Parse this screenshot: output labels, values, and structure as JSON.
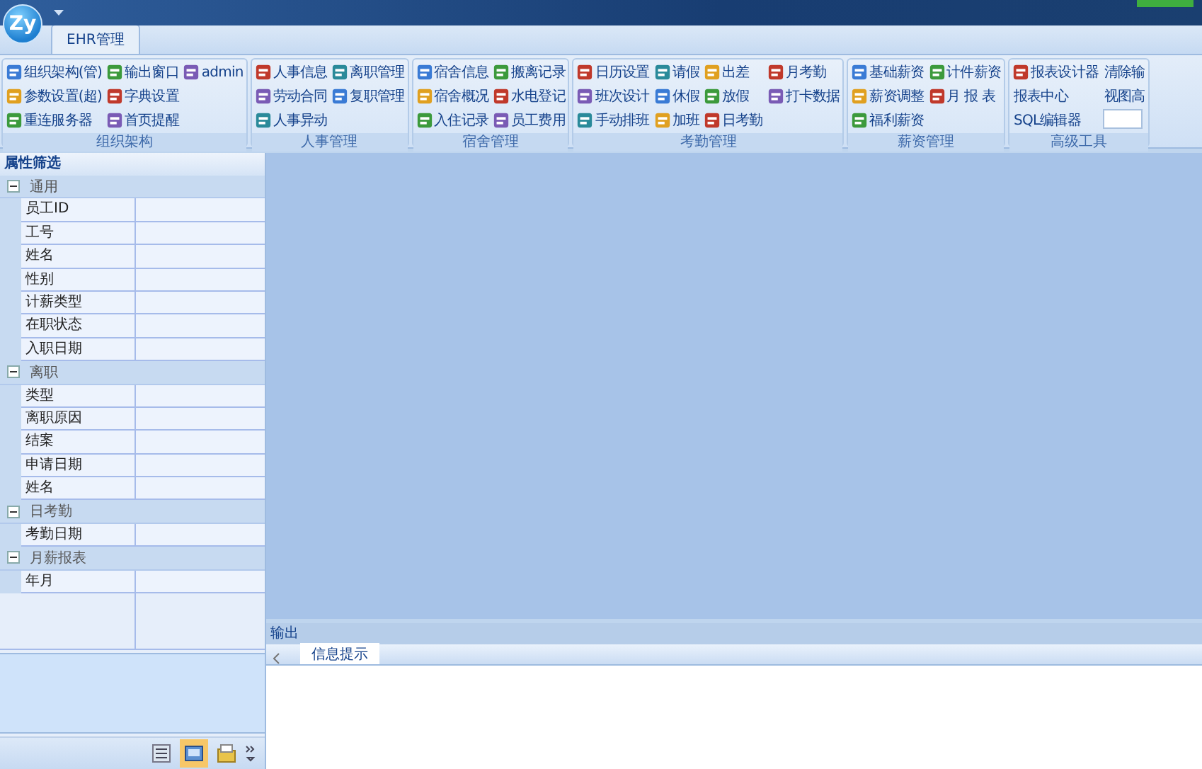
{
  "app": {
    "logo": "Zy"
  },
  "tabs": [
    {
      "label": "EHR管理",
      "selected": true
    }
  ],
  "ribbon": [
    {
      "title": "组织架构",
      "columns": [
        [
          {
            "label": "组织架构(管)",
            "kind": "icon"
          },
          {
            "label": "参数设置(超)",
            "kind": "icon"
          },
          {
            "label": "重连服务器",
            "kind": "icon"
          }
        ],
        [
          {
            "label": "输出窗口",
            "kind": "icon"
          },
          {
            "label": "字典设置",
            "kind": "icon"
          },
          {
            "label": "首页提醒",
            "kind": "icon"
          }
        ],
        [
          {
            "label": "admin",
            "kind": "icon"
          }
        ]
      ]
    },
    {
      "title": "人事管理",
      "columns": [
        [
          {
            "label": "人事信息",
            "kind": "icon"
          },
          {
            "label": "劳动合同",
            "kind": "icon"
          },
          {
            "label": "人事异动",
            "kind": "icon"
          }
        ],
        [
          {
            "label": "离职管理",
            "kind": "icon"
          },
          {
            "label": "复职管理",
            "kind": "icon"
          }
        ]
      ]
    },
    {
      "title": "宿舍管理",
      "columns": [
        [
          {
            "label": "宿舍信息",
            "kind": "icon"
          },
          {
            "label": "宿舍概况",
            "kind": "icon"
          },
          {
            "label": "入住记录",
            "kind": "icon"
          }
        ],
        [
          {
            "label": "搬离记录",
            "kind": "icon"
          },
          {
            "label": "水电登记",
            "kind": "icon"
          },
          {
            "label": "员工费用",
            "kind": "icon"
          }
        ]
      ]
    },
    {
      "title": "考勤管理",
      "columns": [
        [
          {
            "label": "日历设置",
            "kind": "icon"
          },
          {
            "label": "班次设计",
            "kind": "icon"
          },
          {
            "label": "手动排班",
            "kind": "icon"
          }
        ],
        [
          {
            "label": "请假",
            "kind": "icon"
          },
          {
            "label": "休假",
            "kind": "icon"
          },
          {
            "label": "加班",
            "kind": "icon"
          }
        ],
        [
          {
            "label": "出差",
            "kind": "icon"
          },
          {
            "label": "放假",
            "kind": "icon"
          },
          {
            "label": "日考勤",
            "kind": "icon"
          }
        ],
        [
          {
            "label": "月考勤",
            "kind": "icon"
          },
          {
            "label": "打卡数据",
            "kind": "icon"
          }
        ]
      ]
    },
    {
      "title": "薪资管理",
      "columns": [
        [
          {
            "label": "基础薪资",
            "kind": "icon"
          },
          {
            "label": "薪资调整",
            "kind": "icon"
          },
          {
            "label": "福利薪资",
            "kind": "icon"
          }
        ],
        [
          {
            "label": "计件薪资",
            "kind": "icon"
          },
          {
            "label": "月 报 表",
            "kind": "icon"
          }
        ]
      ]
    },
    {
      "title": "高级工具",
      "columns": [
        [
          {
            "label": "报表设计器",
            "kind": "icon"
          },
          {
            "label": "报表中心",
            "kind": "text"
          },
          {
            "label": "SQL编辑器",
            "kind": "text"
          }
        ],
        [
          {
            "label": "清除输",
            "kind": "text"
          },
          {
            "label": "视图高",
            "kind": "text"
          },
          {
            "kind": "field"
          }
        ]
      ]
    }
  ],
  "properties": {
    "title": "属性筛选",
    "categories": [
      {
        "name": "通用",
        "expanded": true,
        "rows": [
          "员工ID",
          "工号",
          "姓名",
          "性别",
          "计薪类型",
          "在职状态",
          "入职日期"
        ]
      },
      {
        "name": "离职",
        "expanded": true,
        "rows": [
          "类型",
          "离职原因",
          "结案",
          "申请日期",
          "姓名"
        ]
      },
      {
        "name": "日考勤",
        "expanded": true,
        "rows": [
          "考勤日期"
        ]
      },
      {
        "name": "月薪报表",
        "expanded": true,
        "rows": [
          "年月"
        ]
      }
    ]
  },
  "output": {
    "title": "输出",
    "tabs": [
      {
        "label": "信息提示",
        "selected": true
      }
    ]
  }
}
